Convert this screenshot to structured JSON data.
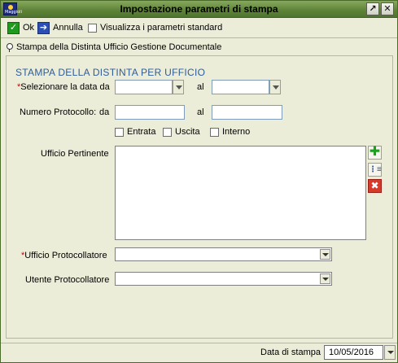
{
  "window": {
    "title": "Impostazione parametri di stampa",
    "app_icon": "maggioli-app-icon",
    "app_icon_text": "Maggioli"
  },
  "titlebar_buttons": [
    {
      "name": "restore",
      "icon": "arrow-up-right-icon",
      "glyph": "↗"
    },
    {
      "name": "close",
      "icon": "close-icon",
      "glyph": "✕"
    }
  ],
  "toolbar": {
    "ok_label": "Ok",
    "ok_icon": "check-icon",
    "annulla_label": "Annulla",
    "annulla_icon": "arrow-right-icon",
    "std_params_label": "Visualizza i parametri standard",
    "std_params_checked": false
  },
  "breadcrumb": {
    "icon": "pin-icon",
    "text": "Stampa della Distinta Ufficio Gestione Documentale"
  },
  "form": {
    "heading": "STAMPA DELLA DISTINTA PER UFFICIO",
    "date_label": "Selezionare la data da",
    "required_mark": "*",
    "date_from_value": "",
    "al_label": "al",
    "date_to_value": "",
    "protocol_label": "Numero Protocollo:",
    "da_label": "da",
    "protocol_from_value": "",
    "protocol_to_value": "",
    "checkboxes": [
      {
        "label": "Entrata",
        "checked": false
      },
      {
        "label": "Uscita",
        "checked": false
      },
      {
        "label": "Interno",
        "checked": false
      }
    ],
    "ufficio_pertinente_label": "Ufficio Pertinente",
    "ufficio_pertinente_items": [],
    "side_buttons": [
      {
        "name": "add",
        "icon": "plus-icon",
        "glyph": "✚"
      },
      {
        "name": "tree",
        "icon": "tree-list-icon",
        "glyph": "⋮≡"
      },
      {
        "name": "remove",
        "icon": "delete-icon",
        "glyph": "✖"
      }
    ],
    "ufficio_protocollatore_label": "Ufficio Protocollatore",
    "ufficio_protocollatore_value": "",
    "utente_protocollatore_label": "Utente Protocollatore",
    "utente_protocollatore_value": ""
  },
  "status_bar": {
    "print_date_label": "Data di stampa",
    "print_date_value": "10/05/2016"
  },
  "colors": {
    "titlebar": "#5d8236",
    "background": "#ecedd9",
    "heading": "#2d5d9c",
    "required": "#d20000"
  }
}
